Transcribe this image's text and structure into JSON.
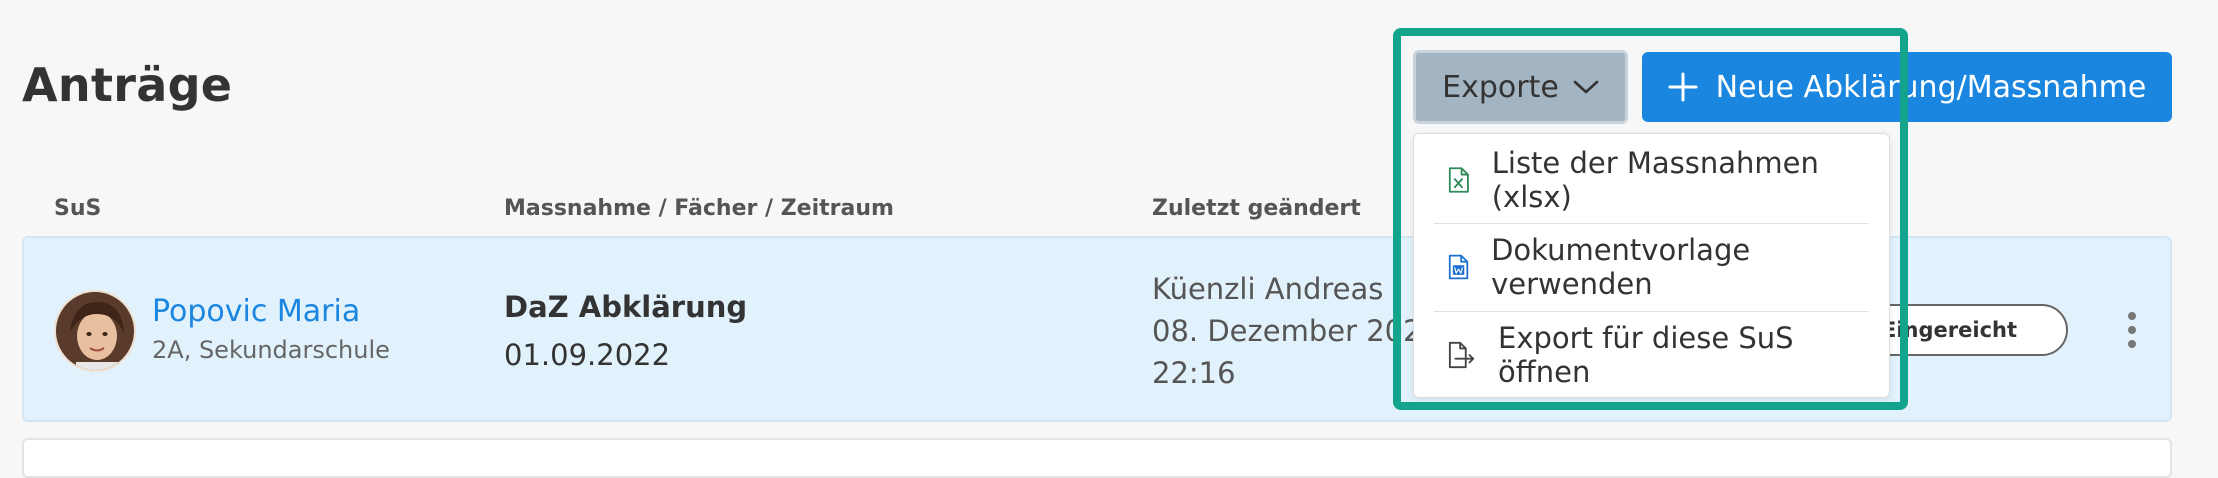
{
  "page": {
    "title": "Anträge"
  },
  "toolbar": {
    "exports_label": "Exporte",
    "new_label": "Neue Abklärung/Massnahme"
  },
  "table": {
    "headers": {
      "student": "SuS",
      "measure": "Massnahme / Fächer / Zeitraum",
      "changed": "Zuletzt geändert"
    },
    "rows": [
      {
        "name": "Popovic Maria",
        "class": "2A, Sekundarschule",
        "measure": "DaZ Abklärung",
        "date": "01.09.2022",
        "changed_by": "Küenzli Andreas",
        "changed_date": "08. Dezember 202",
        "changed_time": "22:16",
        "status": "Eingereicht"
      }
    ]
  },
  "export_menu": {
    "items": [
      {
        "label": "Liste der Massnahmen (xlsx)",
        "icon": "excel-file-icon"
      },
      {
        "label": "Dokumentvorlage verwenden",
        "icon": "word-file-icon"
      },
      {
        "label": "Export für diese SuS öffnen",
        "icon": "file-export-icon"
      }
    ]
  },
  "colors": {
    "primary": "#1a86e0",
    "highlight": "#14a38c",
    "row_bg": "#e2f2fd",
    "excel": "#2e8b57",
    "word": "#1a6fd0"
  }
}
